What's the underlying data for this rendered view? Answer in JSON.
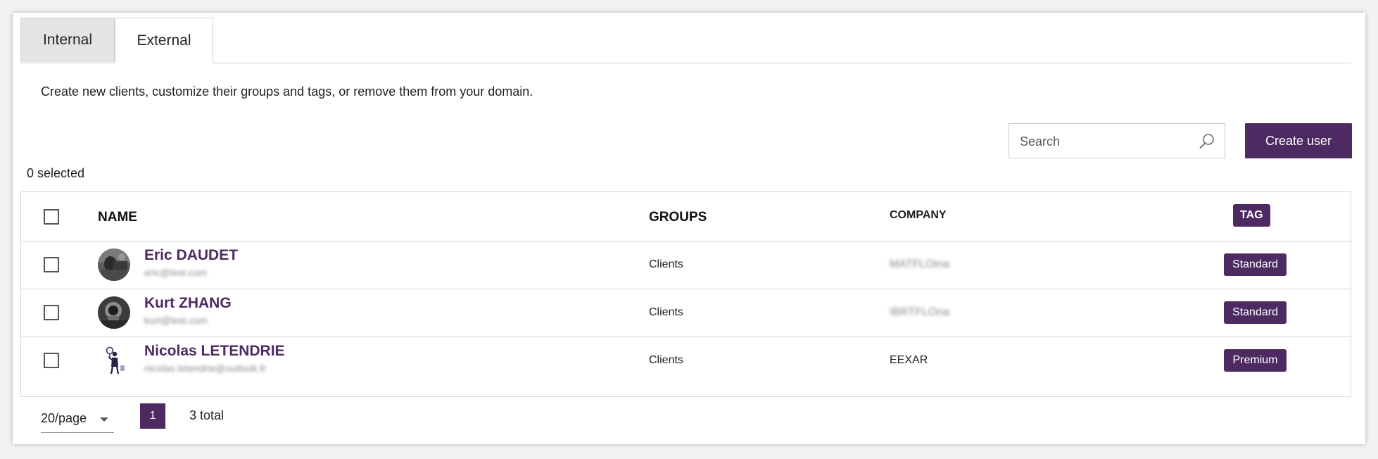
{
  "tabs": [
    {
      "label": "Internal",
      "active": false
    },
    {
      "label": "External",
      "active": true
    }
  ],
  "description": "Create new clients, customize their groups and tags, or remove them from your domain.",
  "search": {
    "placeholder": "Search",
    "value": ""
  },
  "create_button_label": "Create user",
  "selection_status": "0 selected",
  "table": {
    "headers": {
      "name": "NAME",
      "groups": "GROUPS",
      "company": "COMPANY",
      "tag": "TAG"
    },
    "rows": [
      {
        "name": "Eric DAUDET",
        "email": "eric@lest.com",
        "group": "Clients",
        "company": "MATFLOina",
        "tag": "Standard"
      },
      {
        "name": "Kurt ZHANG",
        "email": "kurt@lest.com",
        "group": "Clients",
        "company": "IBRTFLOna",
        "tag": "Standard"
      },
      {
        "name": "Nicolas LETENDRIE",
        "email": "nicolas.letendrie@outlook.fr",
        "group": "Clients",
        "company": "EEXAR",
        "tag": "Premium"
      }
    ]
  },
  "pagination": {
    "page_size": "20/page",
    "current_page": "1",
    "total": "3 total"
  },
  "colors": {
    "accent": "#4d2a62",
    "border": "#d6d6d6",
    "tab_inactive": "#e4e4e4"
  }
}
